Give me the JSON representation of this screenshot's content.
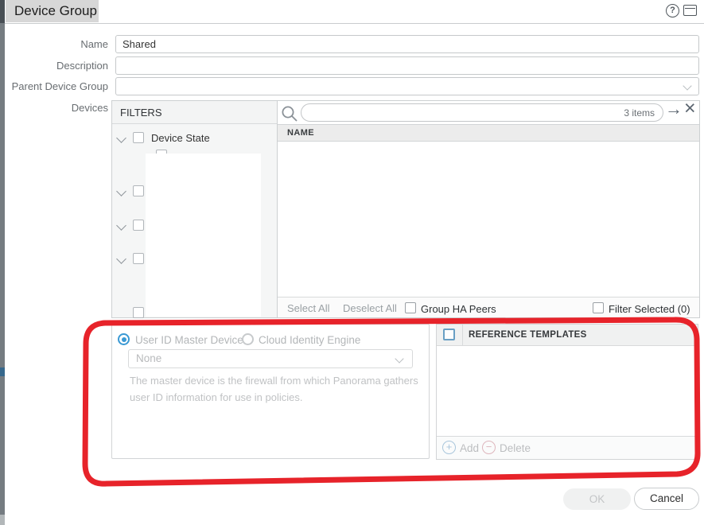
{
  "colors": {
    "annotation_red": "#e7232a",
    "radio_blue": "#3a99d4",
    "title_tab_gray": "#d7d7d7"
  },
  "header": {
    "title": "Device Group",
    "help_glyph": "?"
  },
  "form": {
    "name_label": "Name",
    "name_value": "Shared",
    "description_label": "Description",
    "description_value": "",
    "parent_label": "Parent Device Group",
    "parent_value": "",
    "devices_label": "Devices"
  },
  "filters": {
    "header": "FILTERS",
    "device_state_label": "Device State"
  },
  "device_table": {
    "items_count": "3 items",
    "name_column": "NAME",
    "select_all": "Select All",
    "deselect_all": "Deselect All",
    "group_ha_peers": "Group HA Peers",
    "filter_selected": "Filter Selected (0)"
  },
  "master_device": {
    "radio_user_id": "User ID Master Device",
    "radio_cloud": "Cloud Identity Engine",
    "dropdown_value": "None",
    "help_text": "The master device is the firewall from which Panorama gathers user ID information for use in policies."
  },
  "reference_templates": {
    "header": "REFERENCE TEMPLATES",
    "add_label": "Add",
    "delete_label": "Delete"
  },
  "actions": {
    "ok": "OK",
    "cancel": "Cancel"
  },
  "icons": {
    "arrow_glyph": "→",
    "close_glyph": "×",
    "add_glyph": "+",
    "delete_glyph": "−"
  }
}
